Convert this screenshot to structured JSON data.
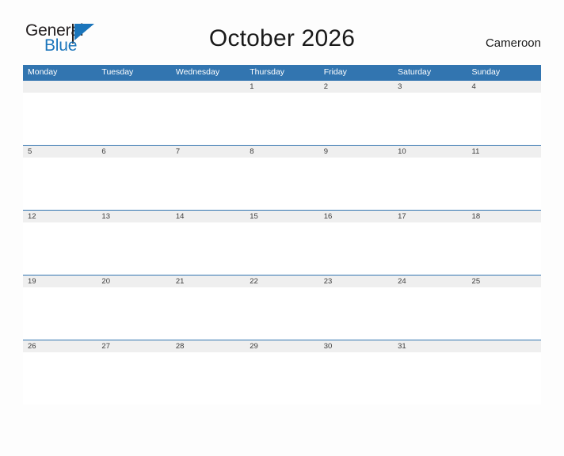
{
  "brand": {
    "name_part1": "General",
    "name_part2": "Blue",
    "flag_icon": "blue-flag-icon",
    "color_primary": "#1b75bb",
    "color_text": "#231f20"
  },
  "header": {
    "title": "October 2026",
    "locale": "Cameroon"
  },
  "calendar": {
    "accent_color": "#3275b0",
    "date_strip_color": "#efefef",
    "weekdays": [
      "Monday",
      "Tuesday",
      "Wednesday",
      "Thursday",
      "Friday",
      "Saturday",
      "Sunday"
    ],
    "weeks": [
      [
        "",
        "",
        "",
        "1",
        "2",
        "3",
        "4"
      ],
      [
        "5",
        "6",
        "7",
        "8",
        "9",
        "10",
        "11"
      ],
      [
        "12",
        "13",
        "14",
        "15",
        "16",
        "17",
        "18"
      ],
      [
        "19",
        "20",
        "21",
        "22",
        "23",
        "24",
        "25"
      ],
      [
        "26",
        "27",
        "28",
        "29",
        "30",
        "31",
        ""
      ]
    ]
  }
}
